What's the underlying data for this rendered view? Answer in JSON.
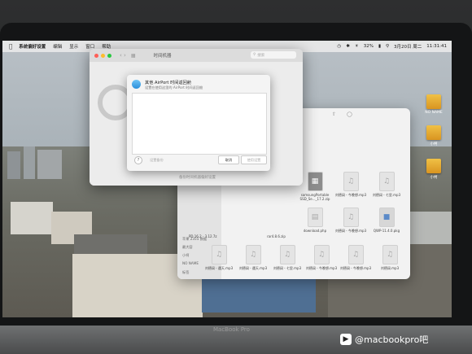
{
  "menubar": {
    "items": [
      "系统偏好设置",
      "编辑",
      "显示",
      "窗口",
      "帮助"
    ],
    "battery": "32%",
    "date": "3月20日 周二",
    "time": "11:31:41"
  },
  "desktop_icons": [
    {
      "label": "NO NAME"
    },
    {
      "label": "小柯"
    },
    {
      "label": "小柯"
    }
  ],
  "time_machine": {
    "title": "时间机器",
    "search_placeholder": "搜索",
    "footer_text": "备份时间机器偏好设置"
  },
  "sheet": {
    "title": "其他 AirPort 时间返回舱",
    "subtitle": "设置在使用这里的 AirPort 时间返回舱",
    "help": "?",
    "link": "设置备份",
    "cancel": "取消",
    "ok": "使用设置"
  },
  "finder": {
    "sidebar": [
      "苹果 2355 数据",
      "最大容",
      "小柯",
      "NO NAME",
      "标签"
    ],
    "files": [
      {
        "name": "PD 16.2 - 3.12.7z",
        "icon": "archive"
      },
      {
        "name": "刘德阔 - 遇天.mp3",
        "icon": "audio"
      },
      {
        "name": "刘德阔 - 遇天.mp3",
        "icon": "audio"
      },
      {
        "name": "刘德阔 - 七里.mp3",
        "icon": "audio"
      },
      {
        "name": "刘德阔 - 今晚想.mp3",
        "icon": "audio"
      },
      {
        "name": "刘德阔 - 今晚想.mp3",
        "icon": "audio"
      },
      {
        "name": "刘德阔.mp3",
        "icon": "audio"
      },
      {
        "name": "samsungPortable SSD_Se..._17.2.zip",
        "icon": "archive"
      },
      {
        "name": "刘德阔 - 今晚想.mp3",
        "icon": "audio"
      },
      {
        "name": "刘德阔 - 七里.mp3",
        "icon": "audio"
      },
      {
        "name": "download.php",
        "icon": "doc"
      },
      {
        "name": "刘德阔 - 今晚想.mp3",
        "icon": "audio"
      },
      {
        "name": "QWP-11.4.0.pkg",
        "icon": "pkg"
      },
      {
        "name": "rar4.8.6.zip",
        "icon": "archive"
      }
    ]
  },
  "device_brand": "MacBook Pro",
  "watermark": "@macbookpro吧",
  "colors": {
    "close": "#ff5f57",
    "minimize": "#febc2e",
    "zoom": "#28c840",
    "link_blue": "#2a8fdb"
  }
}
